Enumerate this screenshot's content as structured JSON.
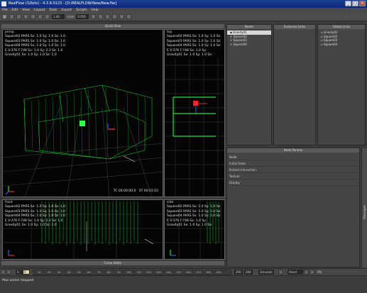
{
  "window": {
    "title": "RealFlow (32bits) - 4.3.8.0123 - [D:/REALFLOW/New/New.flw]"
  },
  "menu": [
    "File",
    "Edit",
    "View",
    "Layout",
    "Tools",
    "Export",
    "Scripts",
    "Help"
  ],
  "toolbar": {
    "scale_label": "scale",
    "scale_value": "0.050",
    "field1": "1.00"
  },
  "panels": {
    "quick_view": "Quick View",
    "nodes": "Nodes",
    "exclusive_links": "Exclusive Links",
    "global_links": "Global Links",
    "node_params": "Node Params",
    "curve_editor": "Curve Editor",
    "side_tab": "Messages"
  },
  "nodes": {
    "items": [
      "Gravity01",
      "Square02",
      "Square03",
      "Square04"
    ]
  },
  "global_links": {
    "items": [
      "Gravity01",
      "Square02",
      "Square03",
      "Square04"
    ]
  },
  "node_params": {
    "sections": [
      "Node",
      "Initial State",
      "Particle Interaction",
      "Texture",
      "Display"
    ]
  },
  "viewports": {
    "persp": {
      "label": "persp",
      "stats": [
        "Square02 PARS Sx: 1.0 Sy: 1.0 Sz: 1.0",
        "Square03 PARS Sx: 1.0 Sy: 1.0 Sz: 1.0",
        "Square04 PARS Sx: 1.0 Sy: 1.0 Sz: 1.0",
        "E V:376 F:748 Sx: 1.0 Sy: 2.3 Sz: 1.0",
        "Gravity01 Sx: 1.0 Sy: 1.0 Sz: 1.0"
      ],
      "tc": "TC 00:00:00:0",
      "st": "ST 00:01:03"
    },
    "top": {
      "label": "top",
      "stats": [
        "Square02 PARS Sx: 1.0 Sy: 1.0 Sz:",
        "Square03 PARS Sx: 1.0 Sy: 1.0 Sz:",
        "Square04 PARS Sx: 1.0 Sy: 1.0 Sz:",
        "E V:376 F:748 Sx: 1.0 Sy:",
        "Gravity01 Sx: 1.0 Sy: 1.0 Sz:"
      ]
    },
    "front": {
      "label": "front",
      "stats": [
        "Square02 PARS Sx: 1.0 Sy: 1.0 Sz: 1.0",
        "Square03 PARS Sx: 1.0 Sy: 1.0 Sz: 1.0",
        "Square04 PARS Sx: 1.0 Sy: 1.0 Sz: 1.0",
        "E V:376 F:748 Sx: 1.0 Sy: 2.3 Sz: 1.0",
        "Gravity01 Sx: 1.0 Sy: 1.0 Sz: 1.0"
      ]
    },
    "side": {
      "label": "side",
      "stats": [
        "Square02 PARS Sx: 1.0 Sy: 1.0 Sz:",
        "Square03 PARS Sx: 1.0 Sy: 1.0 Sz:",
        "Square04 PARS Sx: 1.0 Sy: 1.0 Sz:",
        "E V:376 F:748 Sx: 1.0 Sy:",
        "Gravity01 Sx: 1.0 Sy: 1.0 Sz:"
      ]
    }
  },
  "timeline": {
    "start": "0",
    "current": "0",
    "ticks": [
      "10",
      "20",
      "30",
      "40",
      "50",
      "60",
      "70",
      "80",
      "90",
      "100",
      "110",
      "120",
      "130",
      "140",
      "150",
      "160",
      "170",
      "180",
      "190"
    ],
    "end": "200",
    "end2": "200",
    "mode": "Simulate",
    "reset": "Reset",
    "percent": "0%"
  },
  "status": {
    "message": "Max action stopped"
  },
  "colors": {
    "mesh": "#22e33a",
    "grid": "#555555",
    "panel": "#454545"
  }
}
